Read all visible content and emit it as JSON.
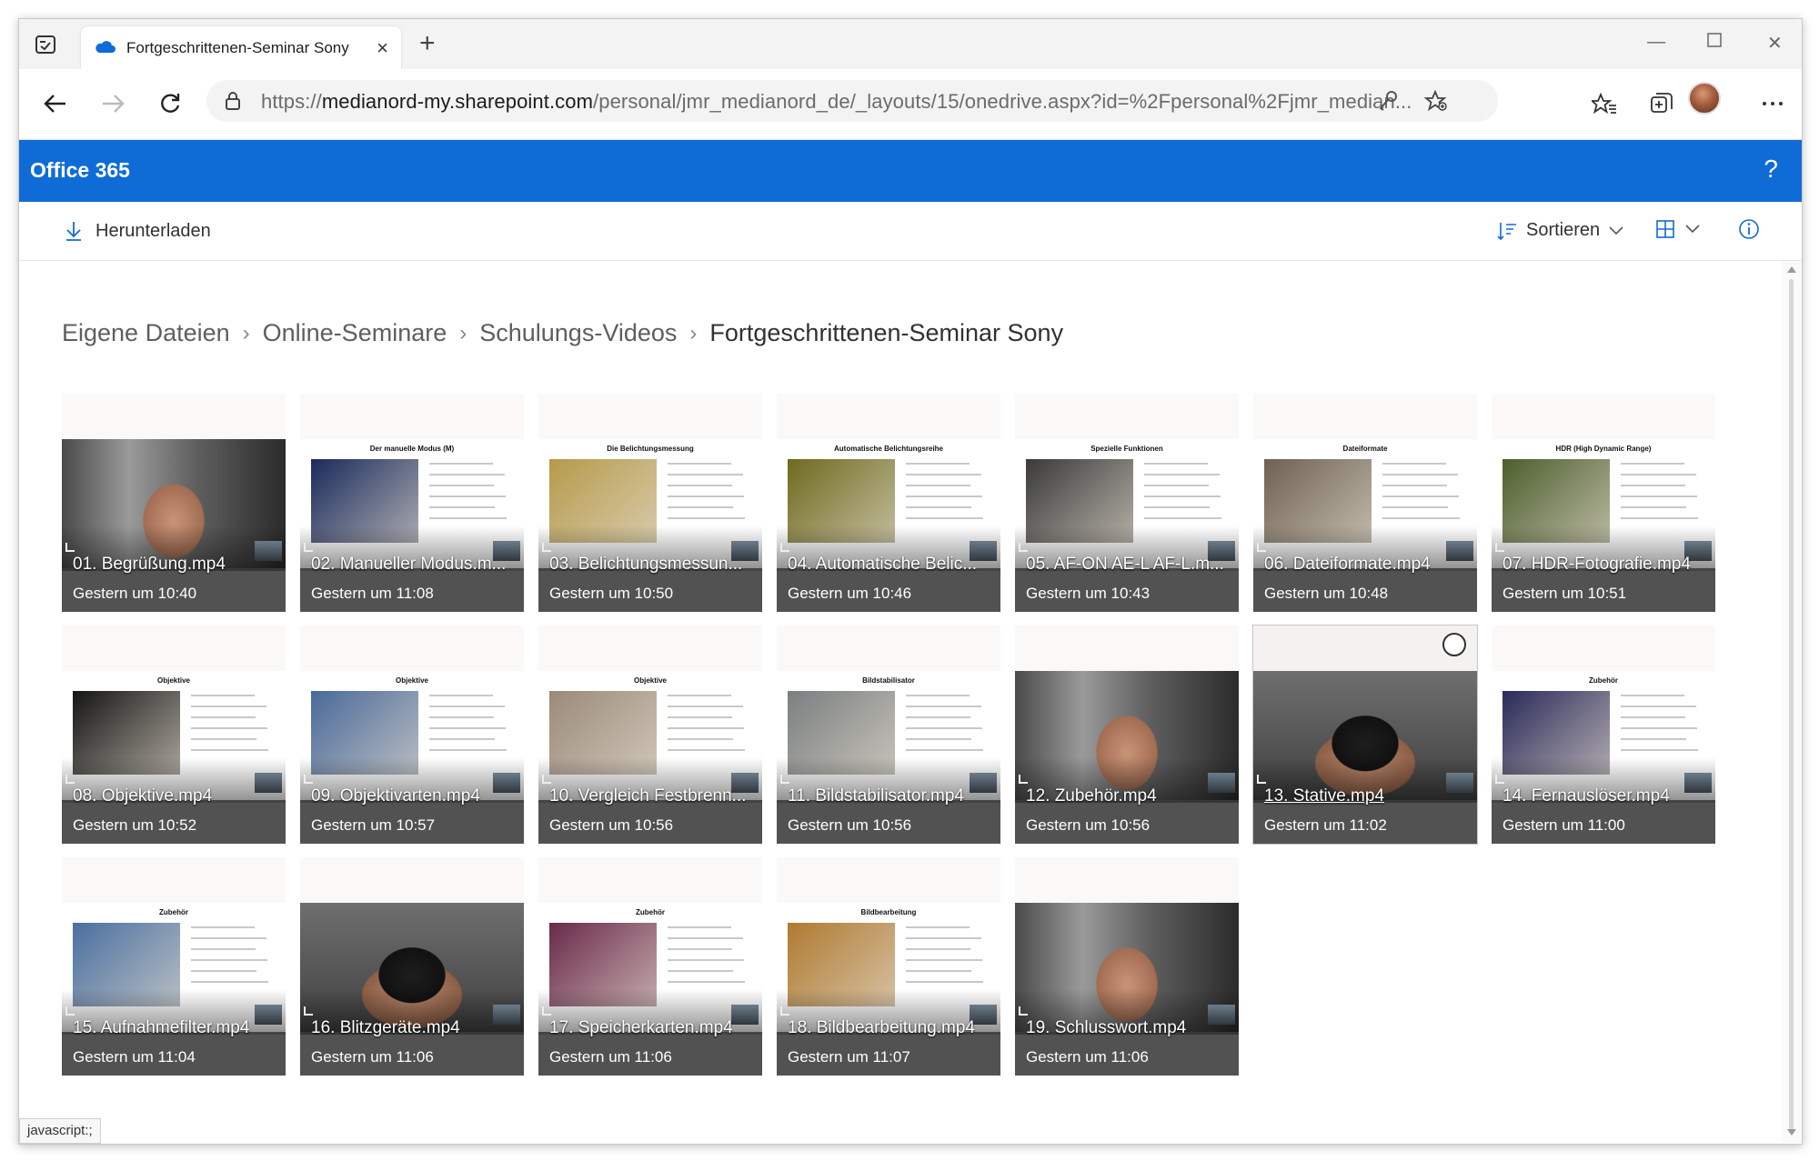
{
  "browser": {
    "tab_title": "Fortgeschrittenen-Seminar Sony",
    "url_prefix": "https://",
    "url_domain": "medianord-my.sharepoint.com",
    "url_path": "/personal/jmr_medianord_de/_layouts/15/onedrive.aspx?id=%2Fpersonal%2Fjmr_median...",
    "status_text": "javascript:;"
  },
  "suitebar": {
    "brand": "Office 365",
    "help": "?"
  },
  "commandbar": {
    "download_label": "Herunterladen",
    "sort_label": "Sortieren"
  },
  "breadcrumb": {
    "items": [
      "Eigene Dateien",
      "Online-Seminare",
      "Schulungs-Videos"
    ],
    "current": "Fortgeschrittenen-Seminar Sony"
  },
  "files": [
    {
      "name": "01. Begrüßung.mp4",
      "date": "Gestern um 10:40",
      "thumb": "speaker"
    },
    {
      "name": "02. Manueller Modus.m...",
      "date": "Gestern um 11:08",
      "thumb": "slide",
      "slide_title": "Der manuelle Modus (M)",
      "color": "#1a2a5c"
    },
    {
      "name": "03. Belichtungsmessun...",
      "date": "Gestern um 10:50",
      "thumb": "slide",
      "slide_title": "Die Belichtungsmessung",
      "color": "#b69a4a"
    },
    {
      "name": "04. Automatische Belic...",
      "date": "Gestern um 10:46",
      "thumb": "slide",
      "slide_title": "Automatische Belichtungsreihe",
      "color": "#6f6a1e"
    },
    {
      "name": "05. AF-ON AE-L AF-L.m...",
      "date": "Gestern um 10:43",
      "thumb": "slide",
      "slide_title": "Spezielle Funktionen",
      "color": "#3a3a3a"
    },
    {
      "name": "06. Dateiformate.mp4",
      "date": "Gestern um 10:48",
      "thumb": "slide",
      "slide_title": "Dateiformate",
      "color": "#6d6152"
    },
    {
      "name": "07. HDR-Fotografie.mp4",
      "date": "Gestern um 10:51",
      "thumb": "slide",
      "slide_title": "HDR (High Dynamic Range)",
      "color": "#4d5e2c"
    },
    {
      "name": "08. Objektive.mp4",
      "date": "Gestern um 10:52",
      "thumb": "slide",
      "slide_title": "Objektive",
      "color": "#151515"
    },
    {
      "name": "09. Objektivarten.mp4",
      "date": "Gestern um 10:57",
      "thumb": "slide",
      "slide_title": "Objektive",
      "color": "#4a6a9a"
    },
    {
      "name": "10. Vergleich Festbrenn...",
      "date": "Gestern um 10:56",
      "thumb": "slide",
      "slide_title": "Objektive",
      "color": "#9a8a7a"
    },
    {
      "name": "11. Bildstabilisator.mp4",
      "date": "Gestern um 10:56",
      "thumb": "slide",
      "slide_title": "Bildstabilisator",
      "color": "#7a7f80"
    },
    {
      "name": "12. Zubehör.mp4",
      "date": "Gestern um 10:56",
      "thumb": "speaker"
    },
    {
      "name": "13. Stative.mp4",
      "date": "Gestern um 11:02",
      "thumb": "hands",
      "hover": true
    },
    {
      "name": "14. Fernauslöser.mp4",
      "date": "Gestern um 11:00",
      "thumb": "slide",
      "slide_title": "Zubehör",
      "color": "#2a2a5a"
    },
    {
      "name": "15. Aufnahmefilter.mp4",
      "date": "Gestern um 11:04",
      "thumb": "slide",
      "slide_title": "Zubehör",
      "color": "#4a6fa0"
    },
    {
      "name": "16. Blitzgeräte.mp4",
      "date": "Gestern um 11:06",
      "thumb": "hands"
    },
    {
      "name": "17. Speicherkarten.mp4",
      "date": "Gestern um 11:06",
      "thumb": "slide",
      "slide_title": "Zubehör",
      "color": "#6a2a4a"
    },
    {
      "name": "18. Bildbearbeitung.mp4",
      "date": "Gestern um 11:07",
      "thumb": "slide",
      "slide_title": "Bildbearbeitung",
      "color": "#b07a30"
    },
    {
      "name": "19. Schlusswort.mp4",
      "date": "Gestern um 11:06",
      "thumb": "speaker"
    }
  ]
}
